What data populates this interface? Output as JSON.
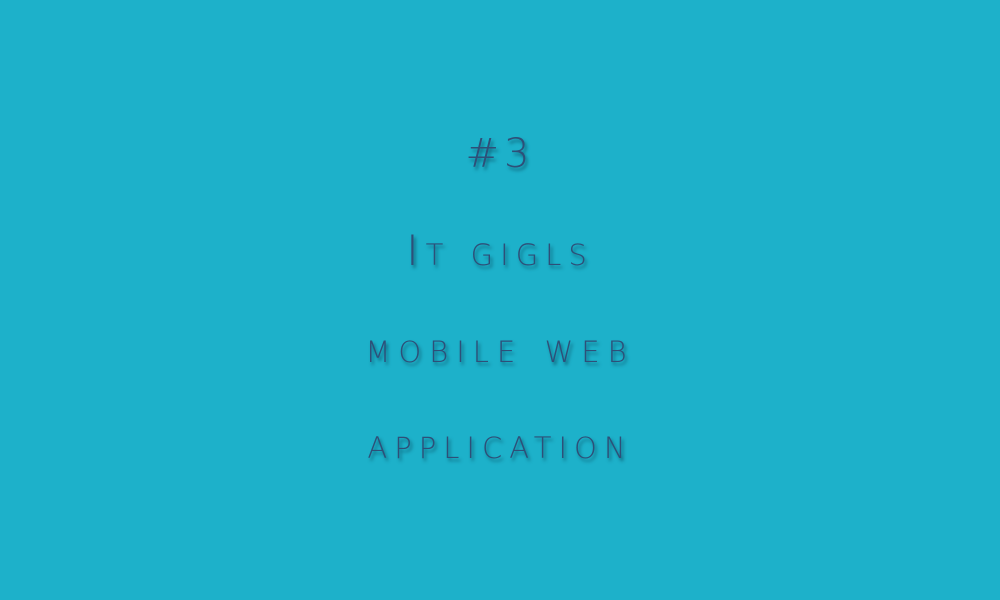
{
  "slide": {
    "number": "#3",
    "title": "It gigls",
    "subtitle_line1": "mobile web",
    "subtitle_line2": "application"
  },
  "colors": {
    "background": "#1db1ca",
    "text": "#2e4f78"
  }
}
